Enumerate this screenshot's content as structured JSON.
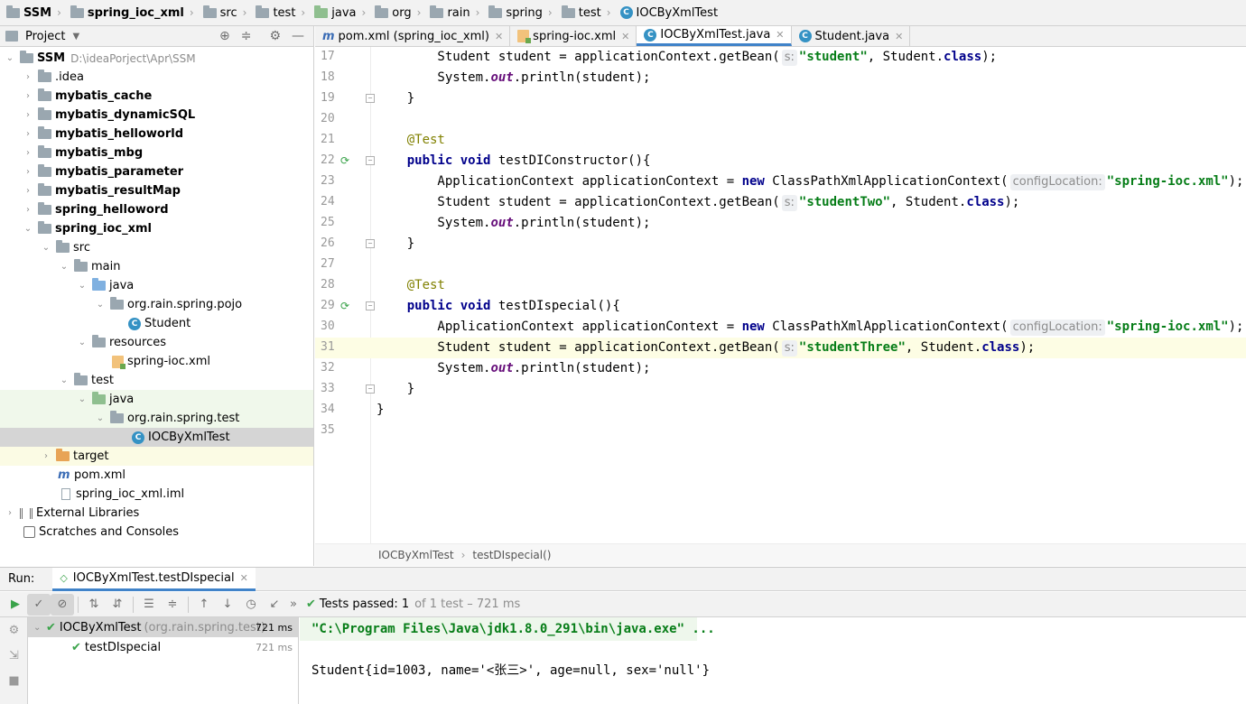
{
  "breadcrumbs": [
    "SSM",
    "spring_ioc_xml",
    "src",
    "test",
    "java",
    "org",
    "rain",
    "spring",
    "test",
    "IOCByXmlTest"
  ],
  "project_panel": {
    "title": "Project",
    "tree": [
      {
        "label": "SSM",
        "path": "D:\\ideaPorject\\Apr\\SSM"
      },
      {
        "label": ".idea"
      },
      {
        "label": "mybatis_cache"
      },
      {
        "label": "mybatis_dynamicSQL"
      },
      {
        "label": "mybatis_helloworld"
      },
      {
        "label": "mybatis_mbg"
      },
      {
        "label": "mybatis_parameter"
      },
      {
        "label": "mybatis_resultMap"
      },
      {
        "label": "spring_helloword"
      },
      {
        "label": "spring_ioc_xml"
      },
      {
        "label": "src"
      },
      {
        "label": "main"
      },
      {
        "label": "java"
      },
      {
        "label": "org.rain.spring.pojo"
      },
      {
        "label": "Student"
      },
      {
        "label": "resources"
      },
      {
        "label": "spring-ioc.xml"
      },
      {
        "label": "test"
      },
      {
        "label": "java"
      },
      {
        "label": "org.rain.spring.test"
      },
      {
        "label": "IOCByXmlTest"
      },
      {
        "label": "target"
      },
      {
        "label": "pom.xml"
      },
      {
        "label": "spring_ioc_xml.iml"
      },
      {
        "label": "External Libraries"
      },
      {
        "label": "Scratches and Consoles"
      }
    ]
  },
  "editor_tabs": [
    {
      "label": "pom.xml (spring_ioc_xml)"
    },
    {
      "label": "spring-ioc.xml"
    },
    {
      "label": "IOCByXmlTest.java"
    },
    {
      "label": "Student.java"
    }
  ],
  "editor": {
    "line_numbers": [
      "17",
      "18",
      "19",
      "20",
      "21",
      "22",
      "23",
      "24",
      "25",
      "26",
      "27",
      "28",
      "29",
      "30",
      "31",
      "32",
      "33",
      "34",
      "35"
    ],
    "code": {
      "l17_a": "        Student student = applicationContext.getBean(",
      "l17_hint": "s:",
      "l17_str": "\"student\"",
      "l17_b": ", Student.",
      "l17_kw": "class",
      "l17_c": ");",
      "l18_a": "        System.",
      "l18_fld": "out",
      "l18_b": ".println(student);",
      "l19": "    }",
      "l21": "    @Test",
      "l22_kw1": "public",
      "l22_kw2": "void",
      "l22_b": " testDIConstructor(){",
      "l23_a": "        ApplicationContext applicationContext = ",
      "l23_kw": "new",
      "l23_b": " ClassPathXmlApplicationContext(",
      "l23_hint": "configLocation:",
      "l23_str": "\"spring-ioc.xml\"",
      "l23_c": ");",
      "l24_a": "        Student student = applicationContext.getBean(",
      "l24_hint": "s:",
      "l24_str": "\"studentTwo\"",
      "l24_b": ", Student.",
      "l24_kw": "class",
      "l24_c": ");",
      "l25_a": "        System.",
      "l25_fld": "out",
      "l25_b": ".println(student);",
      "l26": "    }",
      "l28": "    @Test",
      "l29_kw1": "public",
      "l29_kw2": "void",
      "l29_b": " testDIspecial(){",
      "l30_a": "        ApplicationContext applicationContext = ",
      "l30_kw": "new",
      "l30_b": " ClassPathXmlApplicationContext(",
      "l30_hint": "configLocation:",
      "l30_str": "\"spring-ioc.xml\"",
      "l30_c": ");",
      "l31_a": "        Student student = applicationContext.getBean(",
      "l31_hint": "s:",
      "l31_str": "\"studentThree\"",
      "l31_b": ", Student.",
      "l31_kw": "class",
      "l31_c": ");",
      "l32_a": "        System.",
      "l32_fld": "out",
      "l32_b": ".println(student);",
      "l33": "    }",
      "l34": "}"
    },
    "breadcrumb": [
      "IOCByXmlTest",
      "testDIspecial()"
    ]
  },
  "run": {
    "label": "Run:",
    "tab": "IOCByXmlTest.testDIspecial",
    "status_passed": "Tests passed:",
    "status_count": "1",
    "status_detail": "of 1 test – 721 ms",
    "tree": [
      {
        "name": "IOCByXmlTest",
        "pkg": "(org.rain.spring.test)",
        "time": "721 ms"
      },
      {
        "name": "testDIspecial",
        "time": "721 ms"
      }
    ],
    "console": {
      "command": "\"C:\\Program Files\\Java\\jdk1.8.0_291\\bin\\java.exe\" ...",
      "output": "Student{id=1003, name='<张三>', age=null, sex='null'}"
    }
  },
  "colors": {
    "accent": "#4083c9",
    "pass_green": "#3aa34a",
    "string": "#067d17",
    "keyword": "#00008b"
  }
}
